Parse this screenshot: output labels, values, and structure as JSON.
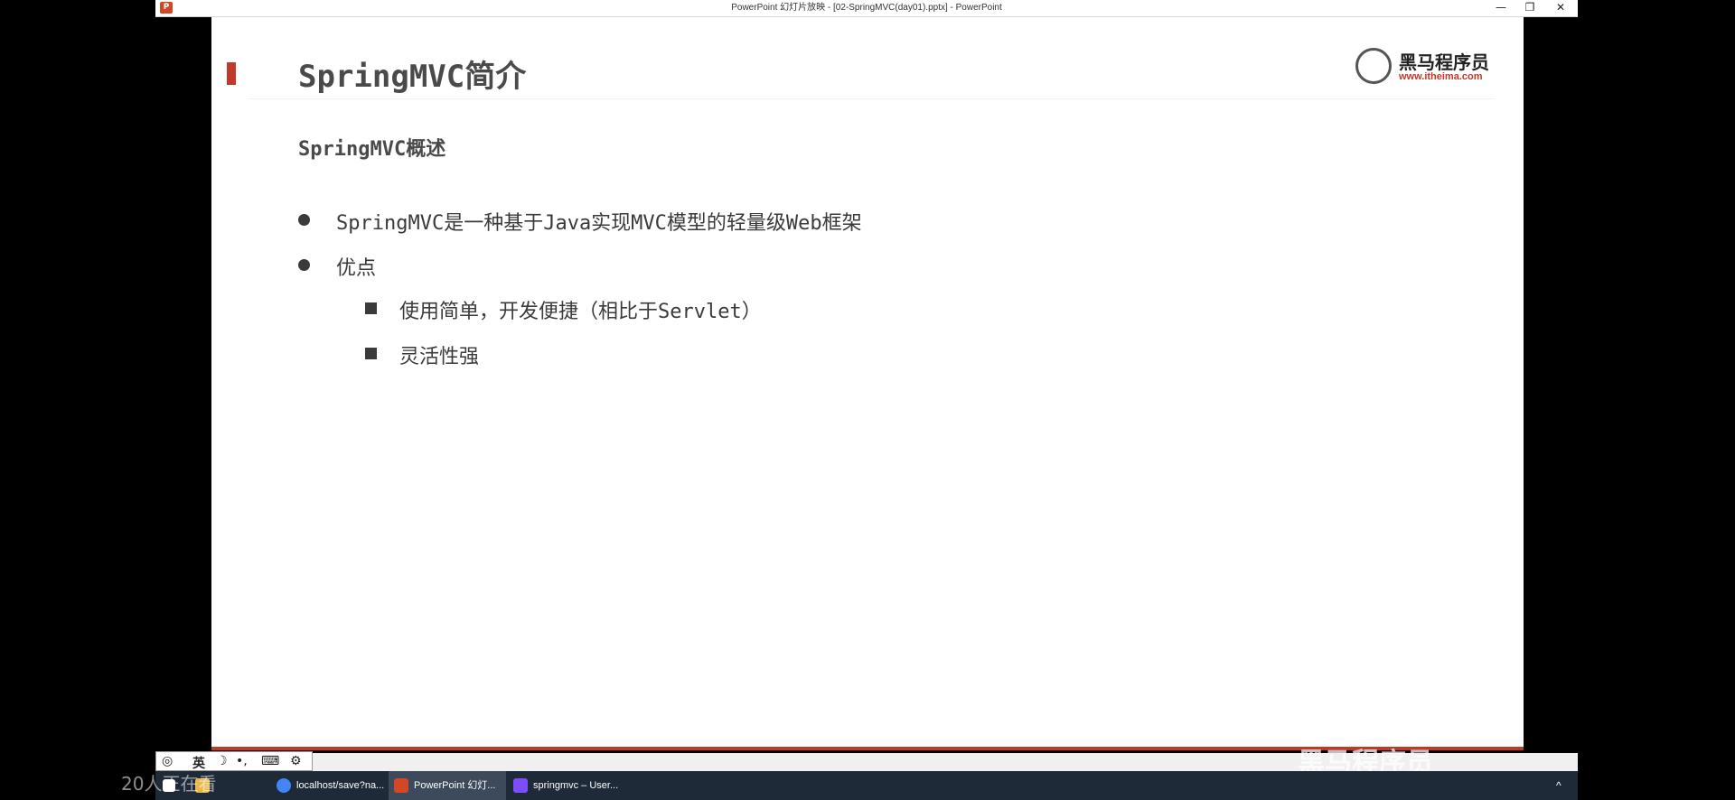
{
  "window": {
    "title": "PowerPoint 幻灯片放映 - [02-SpringMVC(day01).pptx] - PowerPoint",
    "app_icon_letter": "P",
    "minimize": "—",
    "restore": "❐",
    "close": "✕"
  },
  "slide": {
    "title": "SpringMVC简介",
    "logo": {
      "name": "黑马程序员",
      "url": "www.itheima.com"
    },
    "subtitle": "SpringMVC概述",
    "bullets": [
      "SpringMVC是一种基于Java实现MVC模型的轻量级Web框架",
      "优点"
    ],
    "sub_bullets": [
      "使用简单，开发便捷（相比于Servlet）",
      "灵活性强"
    ]
  },
  "ime": {
    "mode": "英"
  },
  "taskbar": {
    "items": [
      {
        "label": "localhost/save?na..."
      },
      {
        "label": "PowerPoint 幻灯..."
      },
      {
        "label": "springmvc – User..."
      }
    ]
  },
  "overlay": {
    "viewer_count": "20人正在看",
    "watermark": "黑马程序员"
  },
  "colors": {
    "accent": "#c0392b",
    "taskbar": "#1f2a38"
  }
}
